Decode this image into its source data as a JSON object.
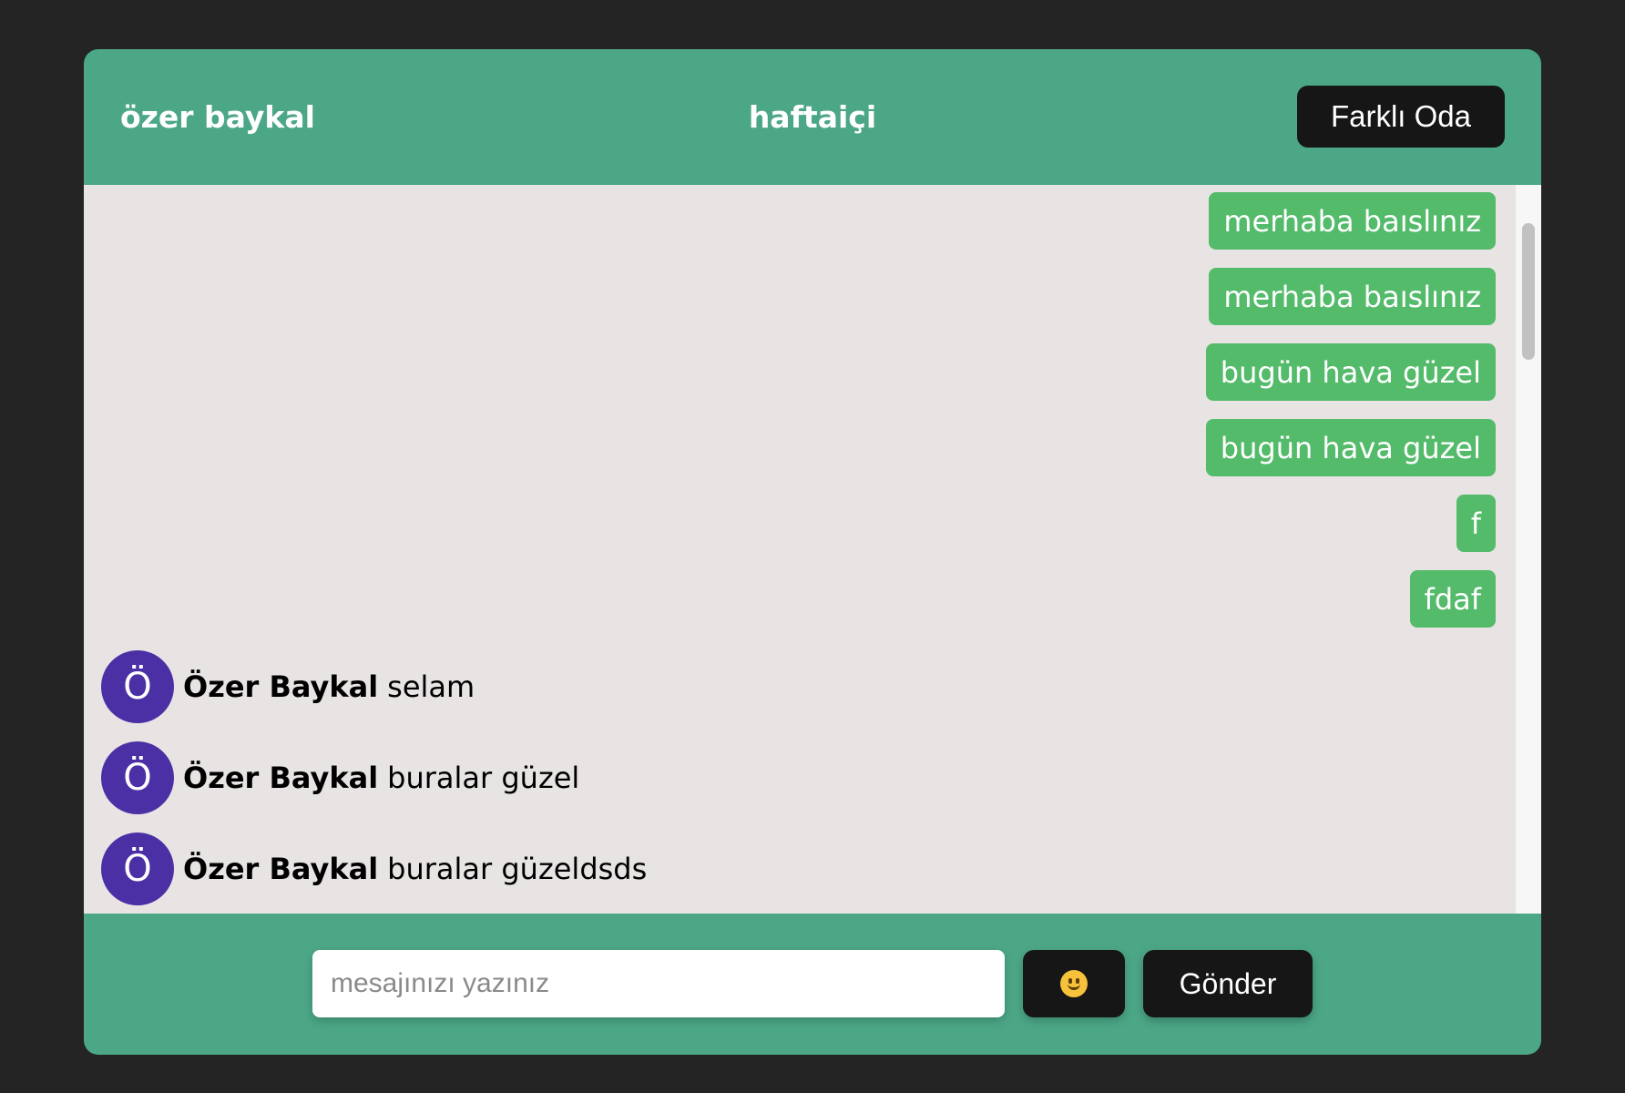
{
  "header": {
    "user_name": "özer baykal",
    "room_name": "haftaiçi",
    "switch_room_label": "Farklı Oda"
  },
  "own_messages": [
    "merhaba baıslınız",
    "merhaba baıslınız",
    "bugün hava güzel",
    "bugün hava güzel",
    "f",
    "fdaf"
  ],
  "other_messages": [
    {
      "avatar_letter": "Ö",
      "sender": "Özer Baykal",
      "text": "selam"
    },
    {
      "avatar_letter": "Ö",
      "sender": "Özer Baykal",
      "text": "buralar güzel"
    },
    {
      "avatar_letter": "Ö",
      "sender": "Özer Baykal",
      "text": "buralar güzeldsds"
    }
  ],
  "composer": {
    "placeholder": "mesajınızı yazınız",
    "value": "",
    "emoji_icon": "smile-emoji-icon",
    "send_label": "Gönder"
  },
  "colors": {
    "panel": "#4ca787",
    "page_bg": "#242424",
    "messages_bg": "#e9e4e4",
    "own_bubble": "#54bb6b",
    "avatar": "#4a30a4",
    "button": "#161616"
  }
}
